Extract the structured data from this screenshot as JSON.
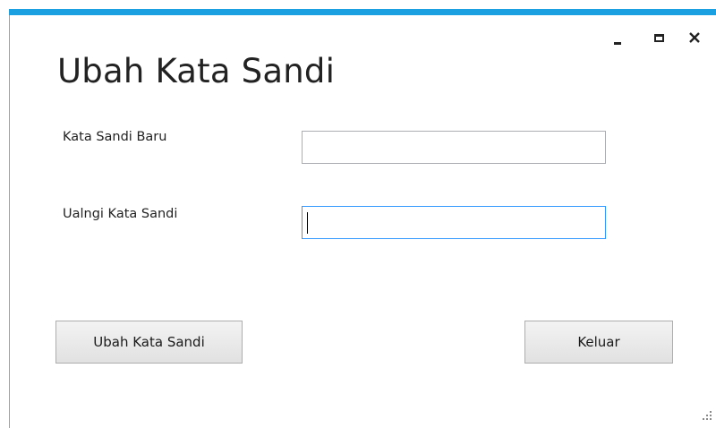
{
  "window": {
    "accent_color": "#1ba1e2",
    "controls": {
      "minimize_icon": "minimize-icon",
      "maximize_icon": "maximize-icon",
      "close_icon": "close-icon"
    }
  },
  "form": {
    "title": "Ubah Kata Sandi",
    "new_password_label": "Kata Sandi Baru",
    "new_password_value": "",
    "confirm_password_label": "Ualngi Kata Sandi",
    "confirm_password_value": "",
    "submit_label": "Ubah Kata Sandi",
    "exit_label": "Keluar"
  }
}
